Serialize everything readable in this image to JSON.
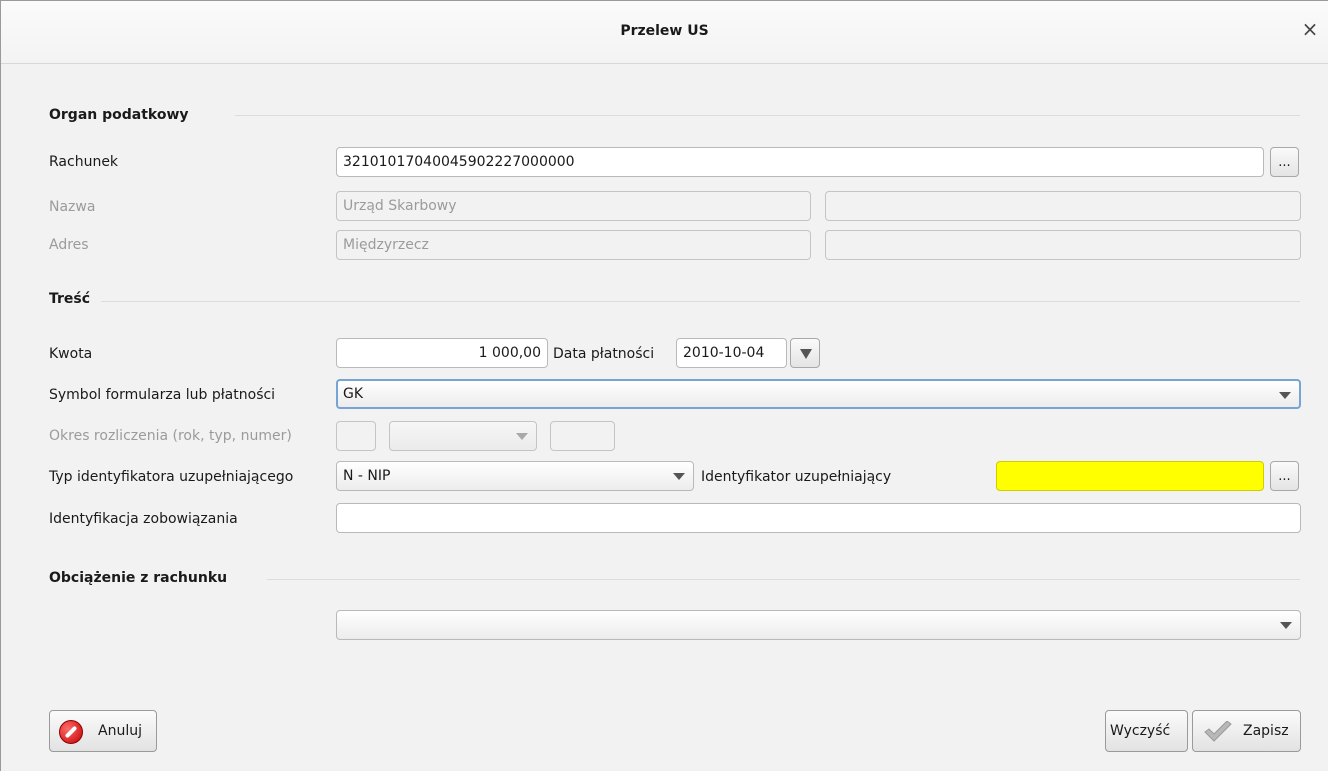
{
  "window": {
    "title": "Przelew US",
    "close_symbol": "×"
  },
  "sections": {
    "organ": "Organ podatkowy",
    "tresc": "Treść",
    "obciazenie": "Obciążenie z rachunku"
  },
  "organ": {
    "rachunek_label": "Rachunek",
    "rachunek_value": "32101017040045902227000000",
    "browse_label": "...",
    "nazwa_label": "Nazwa",
    "nazwa_value": "Urząd Skarbowy",
    "nazwa_value2": "",
    "adres_label": "Adres",
    "adres_value": "Międzyrzecz",
    "adres_value2": ""
  },
  "tresc": {
    "kwota_label": "Kwota",
    "kwota_value": "1 000,00",
    "data_label": "Data płatności",
    "data_value": "2010-10-04",
    "symbol_label": "Symbol formularza lub płatności",
    "symbol_value": "GK",
    "okres_label": "Okres rozliczenia (rok, typ, numer)",
    "okres_rok": "",
    "okres_typ": "",
    "okres_numer": "",
    "typ_id_label": "Typ identyfikatora uzupełniającego",
    "typ_id_value": "N - NIP",
    "id_uzup_label": "Identyfikator uzupełniający",
    "id_uzup_value": "",
    "browse_label": "...",
    "identyfikacja_label": "Identyfikacja zobowiązania",
    "identyfikacja_value": ""
  },
  "obciazenie": {
    "account_value": ""
  },
  "buttons": {
    "anuluj": "Anuluj",
    "wyczysc": "Wyczyść",
    "zapisz": "Zapisz"
  },
  "colors": {
    "required_field": "#ffff00",
    "focus_border": "#76a4d4",
    "cancel_icon": "#d40000"
  },
  "icons": {
    "cancel": "cancel-icon",
    "save": "checkmark-icon",
    "dropdown": "chevron-down-icon"
  }
}
